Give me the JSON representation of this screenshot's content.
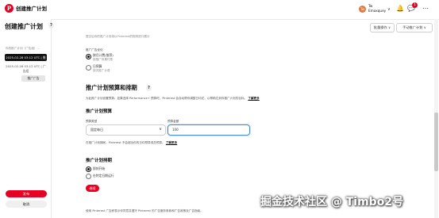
{
  "app": {
    "title": "创建推广计划",
    "logo_glyph": "P"
  },
  "header": {
    "avatar_initial": "Tw",
    "user_name": "Tw",
    "account_name": "Emaxquey",
    "chevron": "∨",
    "icons": [
      "bell-icon",
      "chat-icon",
      "more-icon"
    ],
    "bell_glyph": "🔔",
    "chat_glyph": "💬",
    "more_glyph": "⋯",
    "badge_count": "1",
    "buttons": {
      "bulk_ops": "批量操作",
      "manual": "手动推广计划"
    }
  },
  "left": {
    "page_title": "创建推广计划",
    "help_glyph": "?",
    "schedule_note": "你的推广计划（广告组）...",
    "active_schedule": "2025-02-28 03:12 UTC | 推广计划",
    "schedule_item": "2025-02-28 03:12 UTC | 广告组",
    "gray_button": "推广广告",
    "publish": "发布",
    "cancel": "取消"
  },
  "main": {
    "top_hint": "提交后你的推广计划将以Pinterest的规则进行展示",
    "budget_type_label": "推广广告优化",
    "option1_title": "按月计费(推荐)",
    "option1_desc": "按推广效果付费",
    "option2_title": "日预算",
    "option2_desc": "按天推广计费",
    "section_title": "推广计划预算和排期",
    "section_help": "?",
    "section_desc": "为此推广计划设置预算。如果选择 Performance+ 预算时，Pinterest 会自动帮你调整日均花，以帮助达到你推广计划的目标。",
    "learn_more": "了解更多",
    "budget_sub_title": "推广计划预算",
    "budget_type_field_label": "预算类型",
    "budget_type_value": "固定每日",
    "budget_amount_field_label": "预算金额",
    "budget_amount_value": "100",
    "budget_note": "在推广计划期间，Pinterest 不会超出你的日均预算或总预算。",
    "schedule_sub_title": "推广计划排期",
    "schedule_opt1": "即刻开始",
    "schedule_opt2": "在特定日期运行",
    "next": "继续",
    "footer": "使用 Pinterest 广告即表示你同意并遵守 Pinterest 的广告服务条款和广告政策及广告指南。",
    "footer_link1": "广告服务条款",
    "footer_link2": "广告政策"
  },
  "watermark": "掘金技术社区 @ Timbo2号",
  "colors": {
    "brand": "#e60023",
    "focus": "#4a90d9",
    "avatar": "#e07b3e"
  }
}
